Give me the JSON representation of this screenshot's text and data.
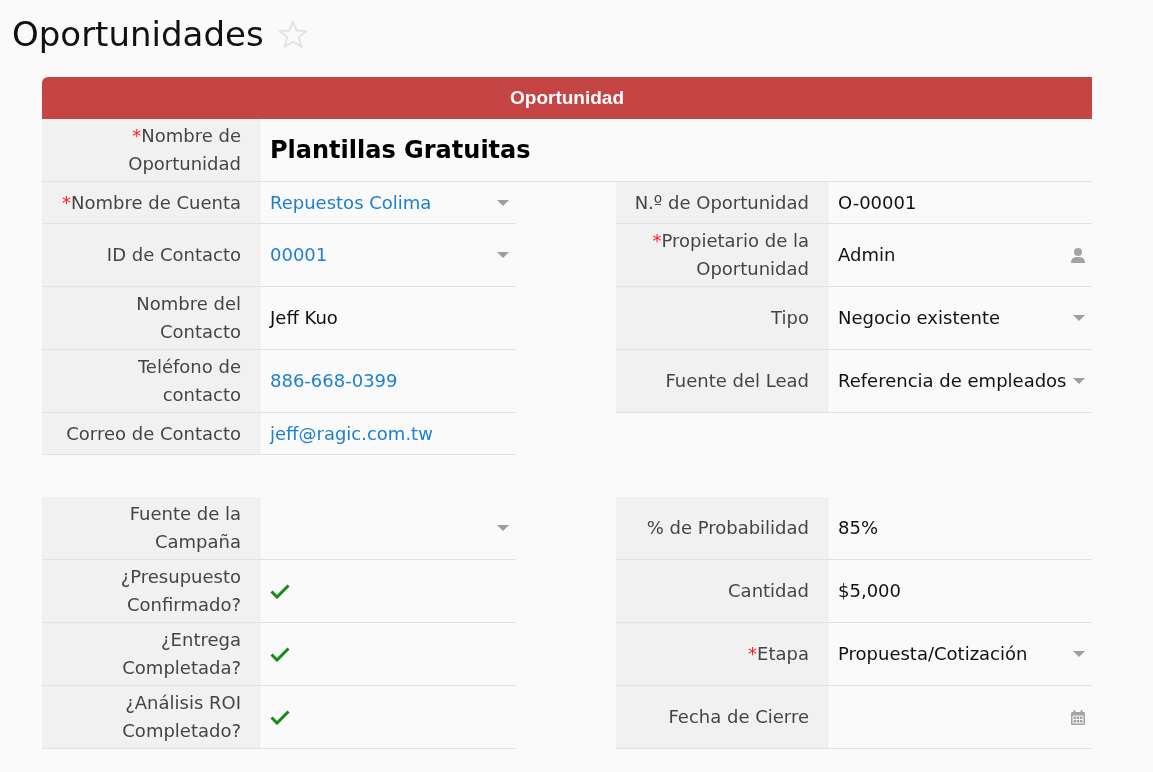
{
  "page": {
    "title": "Oportunidades",
    "favorite": false
  },
  "form": {
    "header": "Oportunidad",
    "required_mark": "*",
    "title_field": {
      "label": "Nombre de Oportunidad",
      "required": true,
      "kind": "text",
      "value": "Plantillas Gratuitas"
    },
    "sections": [
      {
        "rows": [
          {
            "left": {
              "label": "Nombre de Cuenta",
              "required": true,
              "kind": "lookup",
              "value": "Repuestos Colima"
            },
            "right": {
              "label": "N.º de Oportunidad",
              "required": false,
              "kind": "text",
              "value": "O-00001"
            }
          },
          {
            "left": {
              "label": "ID de Contacto",
              "required": false,
              "kind": "lookup",
              "value": "00001"
            },
            "right": {
              "label": "Propietario de la Oportunidad",
              "required": true,
              "kind": "user",
              "value": "Admin"
            }
          },
          {
            "left": {
              "label": "Nombre del Contacto",
              "required": false,
              "kind": "text",
              "value": "Jeff Kuo"
            },
            "right": {
              "label": "Tipo",
              "required": false,
              "kind": "select",
              "value": "Negocio existente"
            }
          },
          {
            "left": {
              "label": "Teléfono de contacto",
              "required": false,
              "kind": "link",
              "value": "886-668-0399"
            },
            "right": {
              "label": "Fuente del Lead",
              "required": false,
              "kind": "select",
              "value": "Referencia de empleados"
            }
          },
          {
            "left": {
              "label": "Correo de Contacto",
              "required": false,
              "kind": "link",
              "value": "jeff@ragic.com.tw"
            }
          }
        ]
      },
      {
        "rows": [
          {
            "left": {
              "label": "Fuente de la Campaña",
              "required": false,
              "kind": "select"
            },
            "right": {
              "label": "% de Probabilidad",
              "required": false,
              "kind": "text",
              "value": "85%"
            }
          },
          {
            "left": {
              "label": "¿Presupuesto Confirmado?",
              "required": false,
              "kind": "checkbox",
              "checked": true
            },
            "right": {
              "label": "Cantidad",
              "required": false,
              "kind": "text",
              "value": "$5,000"
            }
          },
          {
            "left": {
              "label": "¿Entrega Completada?",
              "required": false,
              "kind": "checkbox",
              "checked": true
            },
            "right": {
              "label": "Etapa",
              "required": true,
              "kind": "select",
              "value": "Propuesta/Cotización"
            }
          },
          {
            "left": {
              "label": "¿Análisis ROI Completado?",
              "required": false,
              "kind": "checkbox",
              "checked": true
            },
            "right": {
              "label": "Fecha de Cierre",
              "required": false,
              "kind": "date"
            }
          }
        ]
      }
    ]
  }
}
